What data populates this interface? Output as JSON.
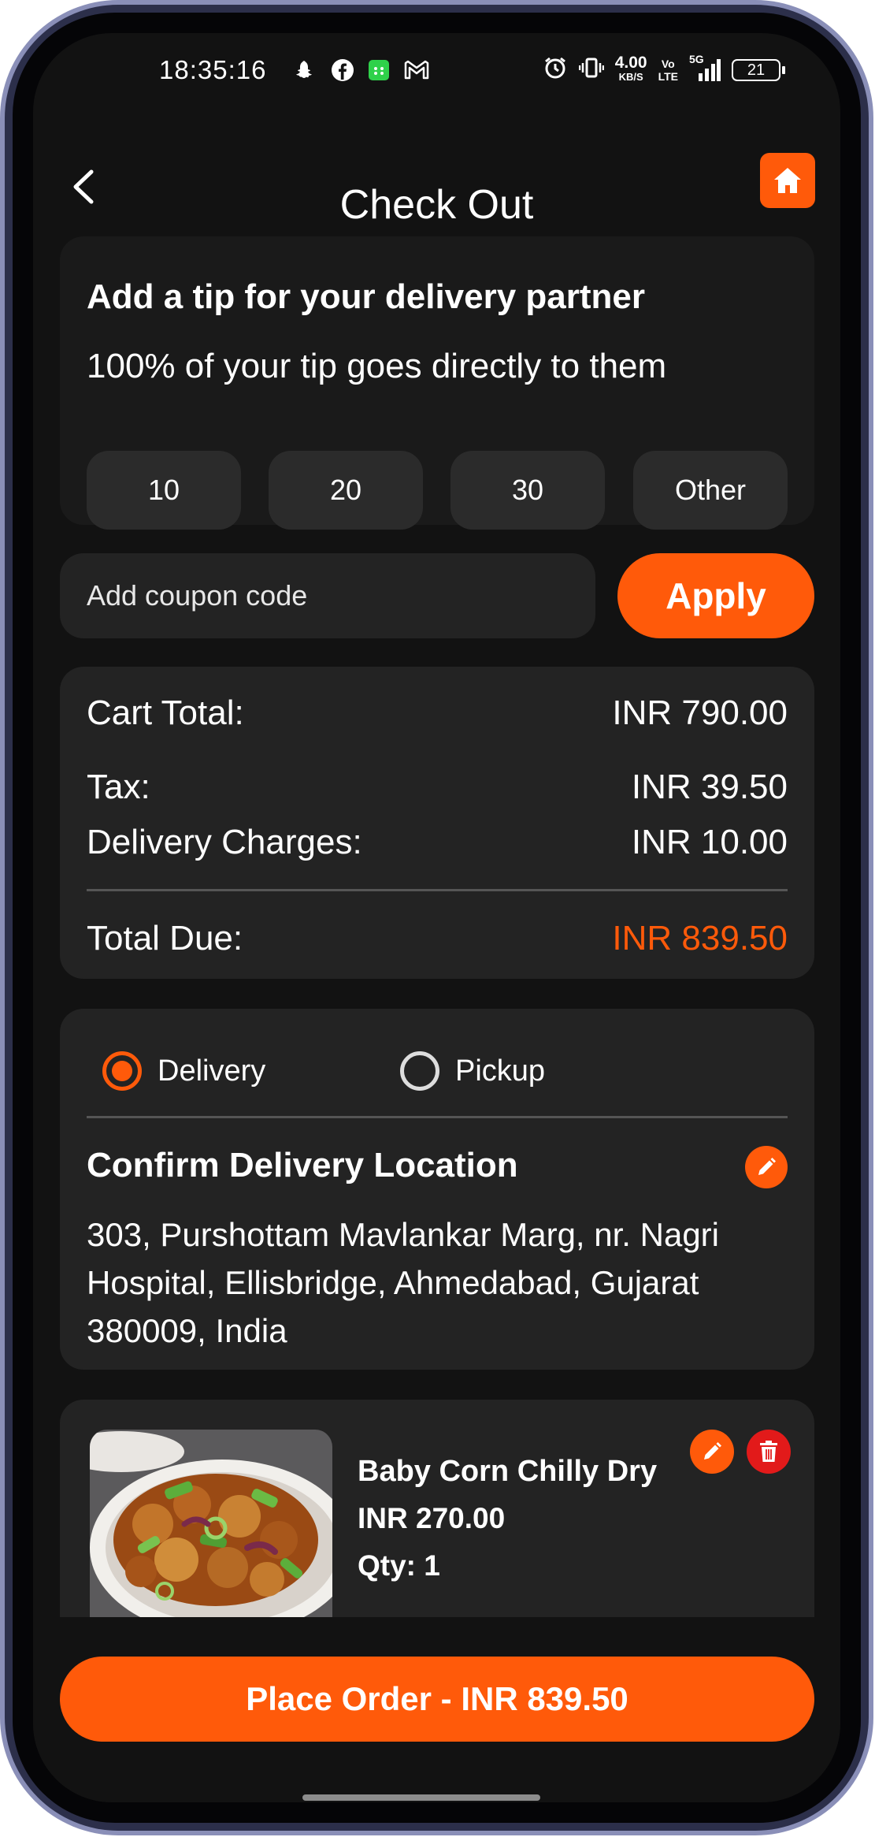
{
  "status_bar": {
    "time": "18:35:16",
    "net_speed_value": "4.00",
    "net_speed_unit": "KB/S",
    "volte_top": "Vo",
    "volte_bottom": "LTE",
    "network": "5G",
    "battery": "21"
  },
  "header": {
    "title": "Check Out"
  },
  "tip": {
    "title": "Add a tip for your delivery partner",
    "subtitle": "100% of your tip goes directly to them",
    "options": [
      "10",
      "20",
      "30",
      "Other"
    ]
  },
  "coupon": {
    "placeholder": "Add coupon code",
    "apply_label": "Apply"
  },
  "summary": {
    "cart_total_label": "Cart Total:",
    "cart_total_value": "INR 790.00",
    "tax_label": "Tax:",
    "tax_value": "INR 39.50",
    "delivery_label": "Delivery Charges:",
    "delivery_value": "INR 10.00",
    "total_due_label": "Total Due:",
    "total_due_value": "INR 839.50"
  },
  "fulfillment": {
    "options": [
      "Delivery",
      "Pickup"
    ],
    "selected": "Delivery",
    "location_title": "Confirm Delivery Location",
    "address": "303, Purshottam Mavlankar Marg, nr. Nagri Hospital, Ellisbridge, Ahmedabad, Gujarat 380009, India"
  },
  "cart_item": {
    "name": "Baby Corn Chilly Dry",
    "price": "INR 270.00",
    "qty": "Qty: 1"
  },
  "place_order": {
    "label": "Place Order - INR 839.50"
  },
  "colors": {
    "accent": "#ff5a0a",
    "delete": "#e21a1a",
    "background": "#121212",
    "card": "#232323"
  }
}
